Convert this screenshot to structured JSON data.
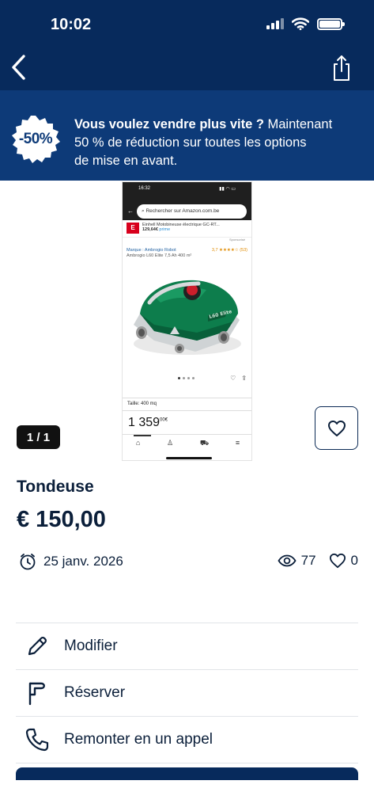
{
  "status_bar": {
    "time": "10:02"
  },
  "promo": {
    "badge": "-50%",
    "headline": "Vous voulez vendre plus vite ?",
    "text_1": "Maintenant",
    "text_2": "50 % de réduction sur toutes les options",
    "text_3": "de mise en avant."
  },
  "gallery": {
    "counter": "1 / 1",
    "photo": {
      "time": "16:32",
      "search_placeholder": "Rechercher sur Amazon.com.be",
      "ad_title": "Einhell Motobineuse électrique GC-RT...",
      "ad_price": "129,64€",
      "ad_prime": "prime",
      "sponsored": "Sponsorisé",
      "brand": "Marque : Ambrogio Robot",
      "rating": "3,7 ★★★★☆ (53)",
      "model": "Ambrogio L60 Elite 7,5 Ah 400 m²",
      "size": "Taille: 400 mq",
      "price_main": "1 359",
      "price_cents": "00€"
    }
  },
  "listing": {
    "title": "Tondeuse",
    "price": "€ 150,00",
    "date": "25 janv. 2026",
    "views": "77",
    "likes": "0"
  },
  "actions": {
    "edit": "Modifier",
    "reserve": "Réserver",
    "bump": "Remonter en un appel"
  },
  "colors": {
    "header_bg": "#072a5c",
    "promo_bg": "#0d3a78",
    "text_primary": "#0b1f3a"
  }
}
